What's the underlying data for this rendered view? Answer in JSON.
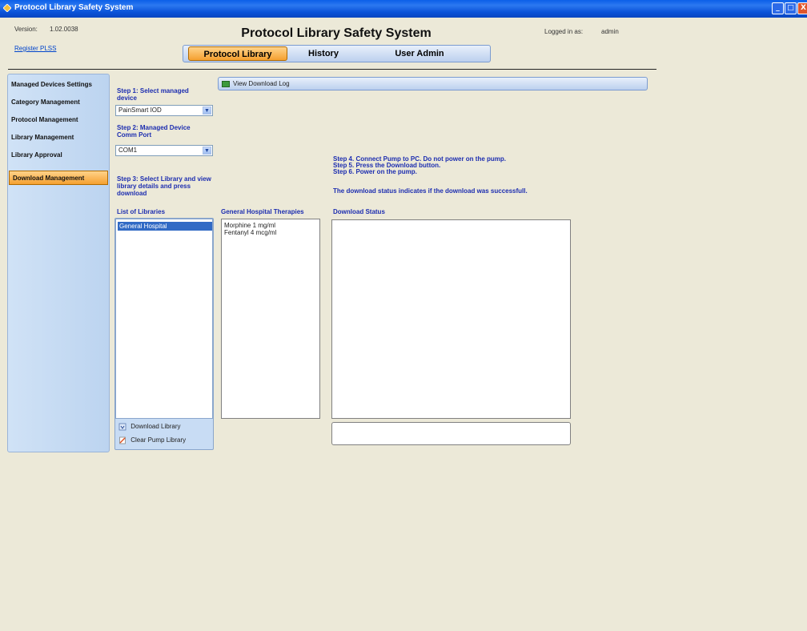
{
  "window": {
    "title": "Protocol Library Safety System",
    "buttons": {
      "minimize": "_",
      "maximize": "□",
      "close": "X"
    }
  },
  "header": {
    "version_label": "Version:",
    "version_value": "1.02.0038",
    "register_link": "Register PLSS",
    "app_title": "Protocol Library Safety System",
    "logged_in_label": "Logged in as:",
    "logged_in_user": "admin",
    "tabs": [
      {
        "label": "Protocol Library",
        "active": true
      },
      {
        "label": "History",
        "active": false
      },
      {
        "label": "User Admin",
        "active": false
      }
    ]
  },
  "sidebar": {
    "items": [
      {
        "label": "Managed Devices Settings",
        "active": false
      },
      {
        "label": "Category Management",
        "active": false
      },
      {
        "label": "Protocol Management",
        "active": false
      },
      {
        "label": "Library Management",
        "active": false
      },
      {
        "label": "Library Approval",
        "active": false
      },
      {
        "label": "Download Management",
        "active": true
      }
    ]
  },
  "steps": {
    "step1": "Step 1: Select managed device",
    "device_select": "PainSmart IOD",
    "step2": "Step 2: Managed Device Comm Port",
    "port_select": "COM1",
    "step3": "Step 3: Select Library and view library details and press download"
  },
  "libraries": {
    "header": "List of Libraries",
    "items": [
      "General Hospital"
    ],
    "download_button": "Download Library",
    "clear_button": "Clear Pump Library"
  },
  "therapies": {
    "header": "General Hospital Therapies",
    "items": [
      "Morphine 1 mg/ml",
      "Fentanyl 4 mcg/ml"
    ]
  },
  "download": {
    "view_log_button": "View Download Log",
    "step4": "Step 4. Connect Pump to PC. Do not power on the pump.",
    "step5": "Step 5. Press the Download button.",
    "step6": "Step 6. Power on the pump.",
    "status_note": "The download status indicates if the download was successfull.",
    "status_header": "Download Status",
    "status_text": ""
  },
  "colors": {
    "accent_orange": "#f5a030",
    "step_text_blue": "#1c2db0",
    "titlebar_blue": "#0a52d8",
    "selection_blue": "#316ac5"
  }
}
